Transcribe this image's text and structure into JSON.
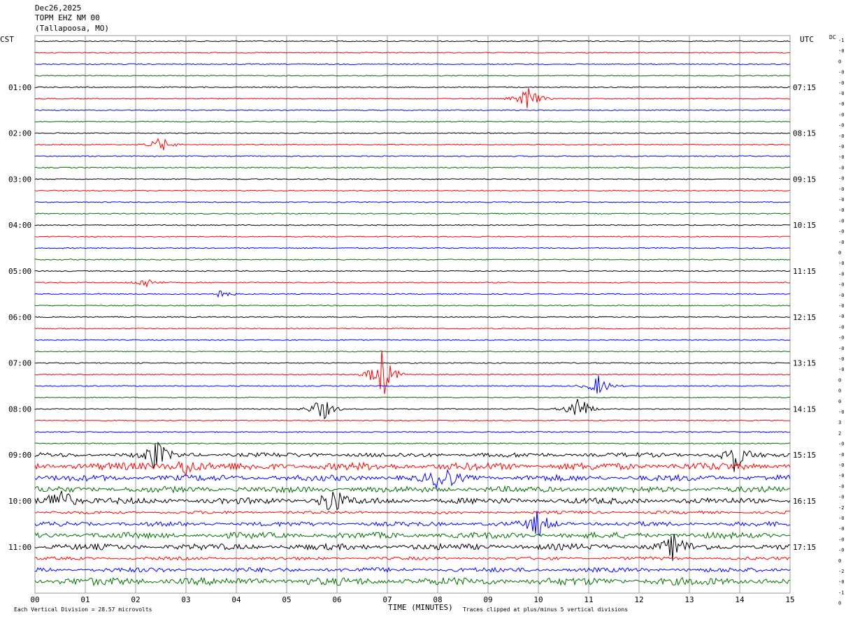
{
  "header": {
    "date": "Dec26,2025",
    "station": "TOPM EHZ NM 00",
    "location": "(Tallapoosa, MO)"
  },
  "left_tz": "CST",
  "right_tz": "UTC",
  "dc_label": "DC",
  "footer": {
    "note_left": "Each Vertical Division =   28.57 microvolts",
    "note_right": "Traces clipped at plus/minus 5 vertical divisions"
  },
  "colors": {
    "trace": [
      "#000000",
      "#ff0000",
      "#0000ff",
      "#007000"
    ],
    "grid": "#999999"
  },
  "chart_data": {
    "type": "line",
    "title": "TOPM EHZ NM 00",
    "xlabel": "TIME (MINUTES)",
    "ylabel": "",
    "x_range": [
      0,
      15
    ],
    "x_ticks": [
      "00",
      "01",
      "02",
      "03",
      "04",
      "05",
      "06",
      "07",
      "08",
      "09",
      "10",
      "11",
      "12",
      "13",
      "14",
      "15"
    ],
    "rows_per_hour": 4,
    "row_count": 48,
    "left_labels": [
      "01:00",
      "02:00",
      "03:00",
      "04:00",
      "05:00",
      "06:00",
      "07:00",
      "08:00",
      "09:00",
      "10:00",
      "11:00"
    ],
    "right_labels": [
      "07:15",
      "08:15",
      "09:15",
      "10:15",
      "11:15",
      "12:15",
      "13:15",
      "14:15",
      "15:15",
      "16:15",
      "17:15"
    ],
    "dc_offsets": [
      "-1",
      "-0",
      "0",
      "-0",
      "-0",
      "-0",
      "-0",
      "-0",
      "-0",
      "-0",
      "-0",
      "-0",
      "-0",
      "-0",
      "-0",
      "-0",
      "-0",
      "-0",
      "-0",
      "-0",
      "0",
      "-0",
      "-0",
      "-0",
      "-0",
      "-0",
      "-0",
      "-0",
      "-0",
      "-0",
      "-0",
      "-0",
      "0",
      "0",
      "0",
      "-0",
      "3",
      "2",
      "-0",
      "-0",
      "-0",
      "-0",
      "-0",
      "-0",
      "-2",
      "-0",
      "-0",
      "-0",
      "-0",
      "0",
      "-2",
      "-0",
      "-1",
      "0"
    ],
    "trace_noise_levels": [
      1,
      1,
      1,
      1,
      1,
      1,
      1,
      1,
      1,
      1,
      1,
      1,
      1,
      1,
      1,
      1,
      1,
      1,
      1,
      1,
      1,
      1,
      1,
      1,
      1,
      1,
      1,
      1,
      1,
      1,
      1,
      1,
      1,
      1,
      1,
      1,
      3,
      5,
      4,
      4,
      4,
      2,
      3,
      4,
      4,
      2,
      3,
      5,
      5,
      5,
      5
    ],
    "events": [
      {
        "row": 5,
        "minute": 9.8,
        "amplitude": 5
      },
      {
        "row": 9,
        "minute": 2.5,
        "amplitude": 3
      },
      {
        "row": 21,
        "minute": 2.2,
        "amplitude": 2
      },
      {
        "row": 22,
        "minute": 3.7,
        "amplitude": 1.5
      },
      {
        "row": 29,
        "minute": 6.9,
        "amplitude": 10
      },
      {
        "row": 30,
        "minute": 11.2,
        "amplitude": 4
      },
      {
        "row": 32,
        "minute": 10.8,
        "amplitude": 6
      },
      {
        "row": 32,
        "minute": 5.7,
        "amplitude": 5
      },
      {
        "row": 36,
        "minute": 2.4,
        "amplitude": 6
      },
      {
        "row": 36,
        "minute": 13.9,
        "amplitude": 6
      },
      {
        "row": 37,
        "minute": 3.0,
        "amplitude": 4
      },
      {
        "row": 38,
        "minute": 8.1,
        "amplitude": 6
      },
      {
        "row": 40,
        "minute": 0.5,
        "amplitude": 7
      },
      {
        "row": 40,
        "minute": 5.9,
        "amplitude": 6
      },
      {
        "row": 42,
        "minute": 10.0,
        "amplitude": 5
      },
      {
        "row": 44,
        "minute": 12.7,
        "amplitude": 5
      }
    ]
  }
}
